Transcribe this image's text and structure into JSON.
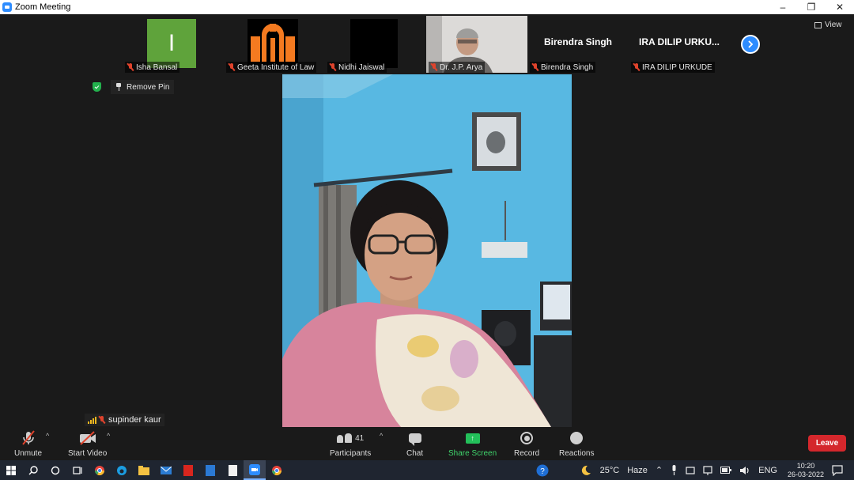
{
  "window": {
    "title": "Zoom Meeting",
    "minimize": "–",
    "restore": "❐",
    "close": "✕"
  },
  "gallery": {
    "tiles": [
      {
        "name": "Isha Bansal",
        "type": "avatar",
        "avatar_letter": "I",
        "muted": true
      },
      {
        "name": "Geeta Institute of Law",
        "type": "logo",
        "muted": true
      },
      {
        "name": "Nidhi Jaiswal",
        "type": "black",
        "muted": true
      },
      {
        "name": "Dr. J.P. Arya",
        "type": "video",
        "muted": true
      },
      {
        "name": "Birendra Singh",
        "display_name": "Birendra Singh",
        "type": "name",
        "muted": true
      },
      {
        "name": "IRA DILIP URKUDE",
        "display_name": "IRA DILIP URKU...",
        "type": "name",
        "muted": true
      }
    ],
    "next_icon": "chevron-right-icon"
  },
  "view_button": {
    "label": "View",
    "icon": "grid-icon"
  },
  "remove_pin": {
    "label": "Remove Pin",
    "icon": "pin-icon"
  },
  "active_speaker": {
    "name": "supinder kaur",
    "muted": true
  },
  "controls": {
    "unmute": {
      "label": "Unmute",
      "icon": "mic-muted-icon"
    },
    "start_video": {
      "label": "Start Video",
      "icon": "video-off-icon"
    },
    "participants": {
      "label": "Participants",
      "count": "41",
      "icon": "participants-icon"
    },
    "chat": {
      "label": "Chat",
      "icon": "chat-icon"
    },
    "share_screen": {
      "label": "Share Screen",
      "icon": "share-screen-icon",
      "color": "#23c05a"
    },
    "record": {
      "label": "Record",
      "icon": "record-icon"
    },
    "reactions": {
      "label": "Reactions",
      "icon": "reactions-icon"
    },
    "leave": {
      "label": "Leave",
      "color": "#d4272c"
    }
  },
  "taskbar": {
    "temperature": "25°C",
    "weather": "Haze",
    "language": "ENG",
    "time": "10:20",
    "date": "26-03-2022"
  },
  "colors": {
    "accent": "#2d8cff",
    "background": "#1a1a1a"
  }
}
